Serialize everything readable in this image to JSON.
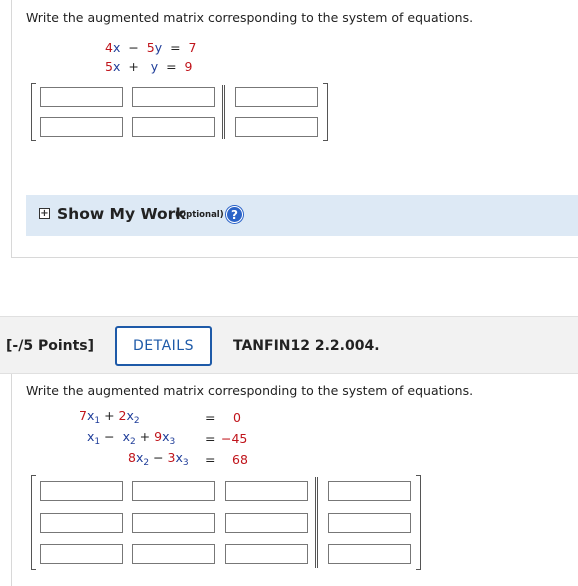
{
  "problem1": {
    "prompt": "Write the augmented matrix corresponding to the system of equations.",
    "eq1": {
      "a": "4",
      "var1": "x",
      "op": "−",
      "b": "5",
      "var2": "y",
      "eq": "=",
      "rhs": "7"
    },
    "eq2": {
      "a": "5",
      "var1": "x",
      "op": "+",
      "var2": "y",
      "eq": "=",
      "rhs": "9"
    }
  },
  "show_my_work": {
    "title": "Show My Work",
    "optional": "(Optional)",
    "help": "?"
  },
  "problem2_header": {
    "points": "[-/5 Points]",
    "details_button": "DETAILS",
    "code": "TANFIN12 2.2.004."
  },
  "problem2": {
    "prompt": "Write the augmented matrix corresponding to the system of equations.",
    "row1": {
      "a": "7",
      "b": "2",
      "rhs": "0"
    },
    "row2": {
      "c": "9",
      "rhs": "−45"
    },
    "row3": {
      "b": "8",
      "c": "3",
      "rhs": "68"
    }
  }
}
